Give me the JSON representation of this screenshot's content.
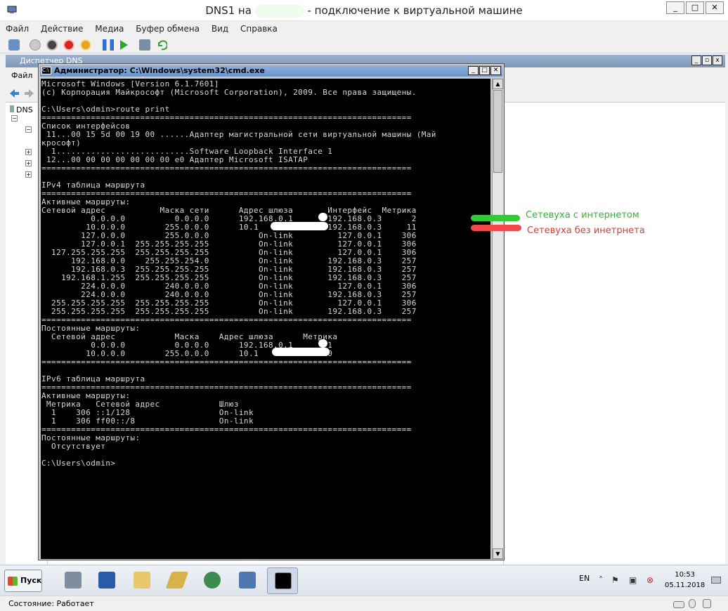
{
  "window": {
    "title_prefix": "DNS1 на",
    "title_suffix": "- подключение к виртуальной машине",
    "min": "_",
    "max": "□",
    "close": "✕"
  },
  "menu": [
    "Файл",
    "Действие",
    "Медиа",
    "Буфер обмена",
    "Вид",
    "Справка"
  ],
  "dns_window": {
    "title": "Диспетчер DNS",
    "menu_first": "Файл",
    "tree_root": "DNS"
  },
  "cmd": {
    "title": "Администратор: C:\\Windows\\system32\\cmd.exe",
    "output": "Microsoft Windows [Version 6.1.7601]\n(c) Корпорация Майкрософт (Microsoft Corporation), 2009. Все права защищены.\n\nC:\\Users\\odmin>route print\n===========================================================================\nСписок интерфейсов\n 11...00 15 5d 00 19 00 ......Адаптер магистральной сети виртуальной машины (Май\nкрософт)\n  1...........................Software Loopback Interface 1\n 12...00 00 00 00 00 00 00 e0 Адаптер Microsoft ISATAP\n===========================================================================\n\nIPv4 таблица маршрута\n===========================================================================\nАктивные маршруты:\nСетевой адрес           Маска сети      Адрес шлюза       Интерфейс  Метрика\n          0.0.0.0          0.0.0.0      192.168.0.1       192.168.0.3      2\n         10.0.0.0        255.0.0.0      10.1              192.168.0.3     11\n        127.0.0.0        255.0.0.0          On-link         127.0.0.1    306\n        127.0.0.1  255.255.255.255          On-link         127.0.0.1    306\n  127.255.255.255  255.255.255.255          On-link         127.0.0.1    306\n      192.168.0.0    255.255.254.0          On-link       192.168.0.3    257\n      192.168.0.3  255.255.255.255          On-link       192.168.0.3    257\n    192.168.1.255  255.255.255.255          On-link       192.168.0.3    257\n        224.0.0.0        240.0.0.0          On-link         127.0.0.1    306\n        224.0.0.0        240.0.0.0          On-link       192.168.0.3    257\n  255.255.255.255  255.255.255.255          On-link         127.0.0.1    306\n  255.255.255.255  255.255.255.255          On-link       192.168.0.3    257\n===========================================================================\nПостоянные маршруты:\n  Сетевой адрес            Маска    Адрес шлюза      Метрика\n          0.0.0.0          0.0.0.0      192.168.0.1       1\n         10.0.0.0        255.0.0.0      10.1             10\n===========================================================================\n\nIPv6 таблица маршрута\n===========================================================================\nАктивные маршруты:\n Метрика   Сетевой адрес            Шлюз\n  1    306 ::1/128                  On-link\n  1    306 ff00::/8                 On-link\n===========================================================================\nПостоянные маршруты:\n  Отсутствует\n\nC:\\Users\\odmin>"
  },
  "annotations": {
    "green_label": "Сетевуха с интернетом",
    "green_color": "#2fb82f",
    "red_label": "Сетевуха без инетрнета",
    "red_color": "#e23a3a"
  },
  "taskbar": {
    "start": "Пуск",
    "lang": "EN",
    "time": "10:53",
    "date": "05.11.2018",
    "items": [
      "server-manager-icon",
      "powershell-icon",
      "explorer-icon",
      "folder-tools-icon",
      "network-icon",
      "hyper-v-icon",
      "cmd-icon"
    ]
  },
  "status": {
    "text": "Состояние: Работает"
  }
}
